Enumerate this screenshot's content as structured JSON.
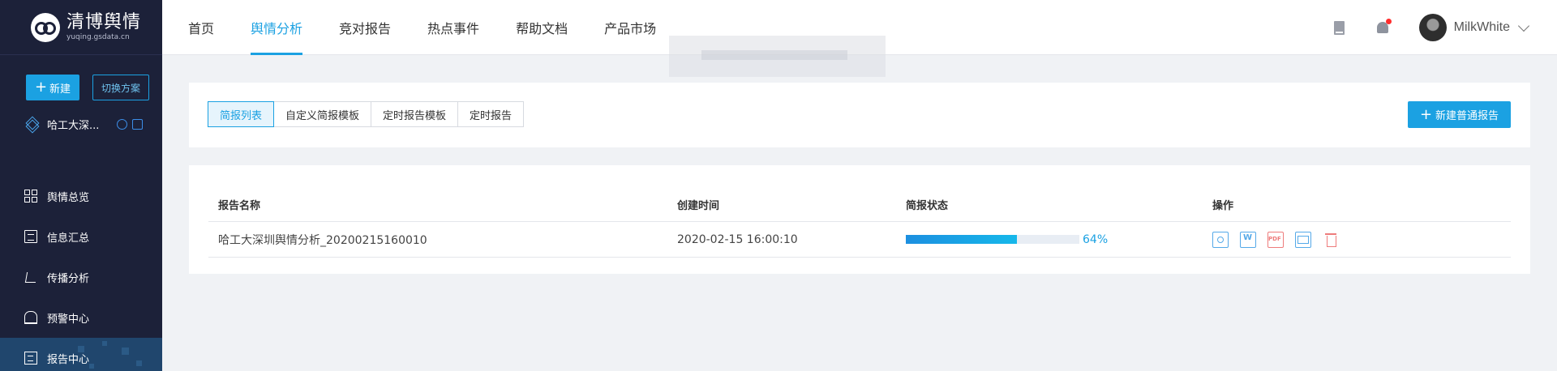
{
  "brand": {
    "name": "清博舆情",
    "domain": "yuqing.gsdata.cn"
  },
  "sidebar": {
    "new_label": "新建",
    "switch_label": "切换方案",
    "scheme_name": "哈工大深...",
    "nav": [
      {
        "label": "舆情总览",
        "icon": "grid-icon"
      },
      {
        "label": "信息汇总",
        "icon": "document-list-icon"
      },
      {
        "label": "传播分析",
        "icon": "share-network-icon"
      },
      {
        "label": "预警中心",
        "icon": "alarm-light-icon"
      },
      {
        "label": "报告中心",
        "icon": "report-icon",
        "active": true
      }
    ]
  },
  "header": {
    "nav": [
      "首页",
      "舆情分析",
      "竞对报告",
      "热点事件",
      "帮助文档",
      "产品市场"
    ],
    "active_nav": "舆情分析",
    "username": "MilkWhite"
  },
  "tabs": [
    "简报列表",
    "自定义简报模板",
    "定时报告模板",
    "定时报告"
  ],
  "active_tab": "简报列表",
  "new_report_label": "新建普通报告",
  "table": {
    "columns": [
      "报告名称",
      "创建时间",
      "简报状态",
      "操作"
    ],
    "rows": [
      {
        "name": "哈工大深圳舆情分析_20200215160010",
        "created": "2020-02-15 16:00:10",
        "progress": 0.64,
        "progress_label": "64%",
        "actions": [
          "view-icon",
          "word-export-icon",
          "pdf-export-icon",
          "email-icon",
          "delete-icon"
        ]
      }
    ]
  },
  "colors": {
    "accent": "#1ba1e2",
    "sidebar_bg": "#1c2139",
    "danger": "#ee7c7c"
  }
}
